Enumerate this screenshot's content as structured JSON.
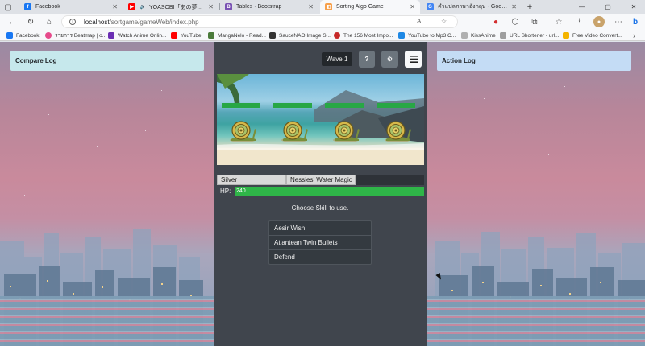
{
  "browser": {
    "tabs": [
      {
        "title": "Facebook",
        "color": "#1877f2",
        "glyph": "f"
      },
      {
        "title": "YOASOBI「あの夢をなぞって」Ti…",
        "color": "#ff0000",
        "glyph": "▶"
      },
      {
        "title": "Tables · Bootstrap",
        "color": "#7952b3",
        "glyph": "B"
      },
      {
        "title": "Sorting Algo Game",
        "color": "#f7a04b",
        "glyph": "◧"
      },
      {
        "title": "คำแปลภาษาอังกฤษ - Google Search",
        "color": "#4285f4",
        "glyph": "G"
      }
    ],
    "active_tab_index": 3,
    "new_tab_glyph": "+",
    "address": {
      "host": "localhost",
      "path": "/sortgame/gameWeb/index.php"
    },
    "bookmarks": [
      {
        "label": "Facebook",
        "color": "#1877f2"
      },
      {
        "label": "รายการ Beatmap | o...",
        "color": "#e64a8b"
      },
      {
        "label": "Watch Anime Onlin...",
        "color": "#6a2db3"
      },
      {
        "label": "YouTube",
        "color": "#ff0000"
      },
      {
        "label": "MangaNelo - Read...",
        "color": "#4a7a3a"
      },
      {
        "label": "SauceNAO Image S...",
        "color": "#333333"
      },
      {
        "label": "The 156 Most Impo...",
        "color": "#c62828"
      },
      {
        "label": "YouTube to Mp3 C...",
        "color": "#1e88e5"
      },
      {
        "label": "KissAnime",
        "color": "#b0b0b0"
      },
      {
        "label": "URL Shortener - url...",
        "color": "#9e9e9e"
      },
      {
        "label": "Free Video Convert...",
        "color": "#f4b400"
      }
    ]
  },
  "panels": {
    "compare_log": "Compare Log",
    "action_log": "Action Log"
  },
  "game": {
    "wave_label": "Wave 1",
    "help_glyph": "?",
    "enemy_count": 4,
    "player": {
      "name": "Silver",
      "status": "Nessies' Water Magic",
      "hp_label": "HP:",
      "hp_value": "240",
      "hp_fraction": 1.0
    },
    "prompt": "Choose Skill to use.",
    "skills": [
      "Aesir Wish",
      "Atlantean Twin Bullets",
      "Defend"
    ]
  },
  "colors": {
    "hp_green": "#2fb548",
    "compare_panel": "#c6e8ec",
    "action_panel": "#c4dcf5",
    "game_bg": "#40454d"
  }
}
